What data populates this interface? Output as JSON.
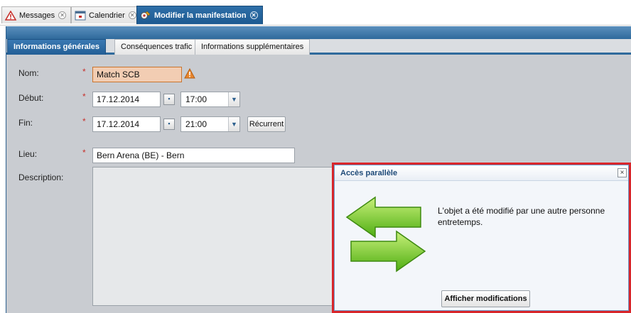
{
  "top_tabs": [
    {
      "label": "Messages",
      "icon": "warning-icon"
    },
    {
      "label": "Calendrier",
      "icon": "calendar-icon"
    },
    {
      "label": "Modifier la manifestation",
      "icon": "event-edit-icon"
    }
  ],
  "sub_tabs": [
    {
      "label": "Informations générales"
    },
    {
      "label": "Conséquences trafic"
    },
    {
      "label": "Informations supplémentaires"
    }
  ],
  "form": {
    "name_label": "Nom:",
    "name_value": "Match SCB",
    "start_label": "Début:",
    "start_date": "17.12.2014",
    "start_time": "17:00",
    "end_label": "Fin:",
    "end_date": "17.12.2014",
    "end_time": "21:00",
    "recurrent_label": "Récurrent",
    "location_label": "Lieu:",
    "location_value": "Bern Arena (BE) - Bern",
    "description_label": "Description:",
    "required_marker": "*"
  },
  "popup": {
    "title": "Accès parallèle",
    "message": "L'objet a été modifié par une autre personne entretemps.",
    "button_label": "Afficher modifications",
    "close_glyph": "×"
  },
  "colors": {
    "accent": "#2f6a9c",
    "invalid_field": "#f2cdb3",
    "popup_border": "#d9262b",
    "arrow_green": "#5fbf1f"
  }
}
